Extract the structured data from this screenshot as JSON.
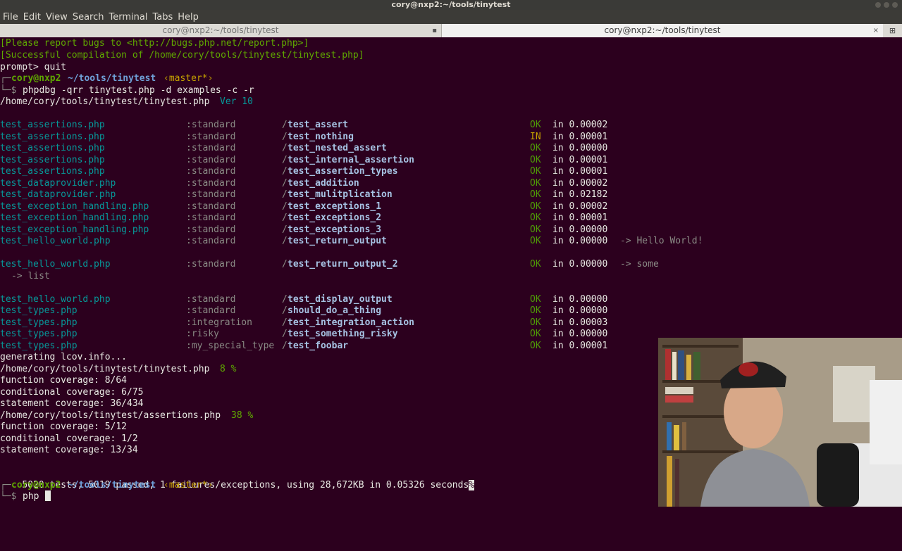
{
  "window": {
    "title": "cory@nxp2:~/tools/tinytest"
  },
  "menu": [
    "File",
    "Edit",
    "View",
    "Search",
    "Terminal",
    "Tabs",
    "Help"
  ],
  "tabs": [
    {
      "label": "cory@nxp2:~/tools/tinytest",
      "active": false
    },
    {
      "label": "cory@nxp2:~/tools/tinytest",
      "active": true
    }
  ],
  "terminal": {
    "header_lines": [
      "[Please report bugs to <http://bugs.php.net/report.php>]",
      "[Successful compilation of /home/cory/tools/tinytest/tinytest.php]",
      "prompt> quit"
    ],
    "prompt": {
      "user": "cory@nxp2",
      "path": "~/tools/tinytest",
      "branch": "‹master*›",
      "symbol": "└─$"
    },
    "command": "phpdbg -qrr tinytest.php -d examples -c -r",
    "version_path": "/home/cory/tools/tinytest/tinytest.php",
    "version_label": "Ver 10",
    "results": [
      {
        "file": "test_assertions.php",
        "group": ":standard",
        "slash": "/",
        "test": "test_assert",
        "status": "OK",
        "time": "in 0.00002",
        "output": ""
      },
      {
        "file": "test_assertions.php",
        "group": ":standard",
        "slash": "/",
        "test": "test_nothing",
        "status": "IN",
        "time": "in 0.00001",
        "output": ""
      },
      {
        "file": "test_assertions.php",
        "group": ":standard",
        "slash": "/",
        "test": "test_nested_assert",
        "status": "OK",
        "time": "in 0.00000",
        "output": ""
      },
      {
        "file": "test_assertions.php",
        "group": ":standard",
        "slash": "/",
        "test": "test_internal_assertion",
        "status": "OK",
        "time": "in 0.00001",
        "output": ""
      },
      {
        "file": "test_assertions.php",
        "group": ":standard",
        "slash": "/",
        "test": "test_assertion_types",
        "status": "OK",
        "time": "in 0.00001",
        "output": ""
      },
      {
        "file": "test_dataprovider.php",
        "group": ":standard",
        "slash": "/",
        "test": "test_addition",
        "status": "OK",
        "time": "in 0.00002",
        "output": ""
      },
      {
        "file": "test_dataprovider.php",
        "group": ":standard",
        "slash": "/",
        "test": "test_mulitplication",
        "status": "OK",
        "time": "in 0.02182",
        "output": ""
      },
      {
        "file": "test_exception_handling.php",
        "group": ":standard",
        "slash": "/",
        "test": "test_exceptions_1",
        "status": "OK",
        "time": "in 0.00002",
        "output": ""
      },
      {
        "file": "test_exception_handling.php",
        "group": ":standard",
        "slash": "/",
        "test": "test_exceptions_2",
        "status": "OK",
        "time": "in 0.00001",
        "output": ""
      },
      {
        "file": "test_exception_handling.php",
        "group": ":standard",
        "slash": "/",
        "test": "test_exceptions_3",
        "status": "OK",
        "time": "in 0.00000",
        "output": ""
      },
      {
        "file": "test_hello_world.php",
        "group": ":standard",
        "slash": "/",
        "test": "test_return_output",
        "status": "OK",
        "time": "in 0.00000",
        "output": "-> Hello World!"
      },
      {
        "file": "test_hello_world.php",
        "group": ":standard",
        "slash": "/",
        "test": "test_return_output_2",
        "status": "OK",
        "time": "in 0.00000",
        "output": "-> some",
        "output_cont": "-> list"
      },
      {
        "file": "test_hello_world.php",
        "group": ":standard",
        "slash": "/",
        "test": "test_display_output",
        "status": "OK",
        "time": "in 0.00000",
        "output": ""
      },
      {
        "file": "test_types.php",
        "group": ":standard",
        "slash": "/",
        "test": "should_do_a_thing",
        "status": "OK",
        "time": "in 0.00000",
        "output": ""
      },
      {
        "file": "test_types.php",
        "group": ":integration",
        "slash": "/",
        "test": "test_integration_action",
        "status": "OK",
        "time": "in 0.00003",
        "output": ""
      },
      {
        "file": "test_types.php",
        "group": ":risky",
        "slash": "/",
        "test": "test_something_risky",
        "status": "OK",
        "time": "in 0.00000",
        "output": ""
      },
      {
        "file": "test_types.php",
        "group": ":my_special_type",
        "slash": "/",
        "test": "test_foobar",
        "status": "OK",
        "time": "in 0.00001",
        "output": ""
      }
    ],
    "generating": "generating lcov.info...",
    "coverage": [
      {
        "path": "/home/cory/tools/tinytest/tinytest.php",
        "pct": "8 %",
        "function": "function coverage: 8/64",
        "conditional": "conditional coverage: 6/75",
        "statement": "statement coverage: 36/434"
      },
      {
        "path": "/home/cory/tools/tinytest/assertions.php",
        "pct": "38 %",
        "function": "function coverage: 5/12",
        "conditional": "conditional coverage: 1/2",
        "statement": "statement coverage: 13/34"
      }
    ],
    "summary": "5020 tests, 5019 passed, 1 failures/exceptions, using 28,672KB in 0.05326 seconds",
    "summary_end": "%",
    "prompt2_input": "php"
  },
  "colors": {
    "background": "#2c001e",
    "ok": "#4e9a06",
    "in": "#c4a000",
    "file": "#06989a",
    "user": "#5fa800"
  },
  "webcam": {
    "icon": "person-webcam-icon"
  }
}
